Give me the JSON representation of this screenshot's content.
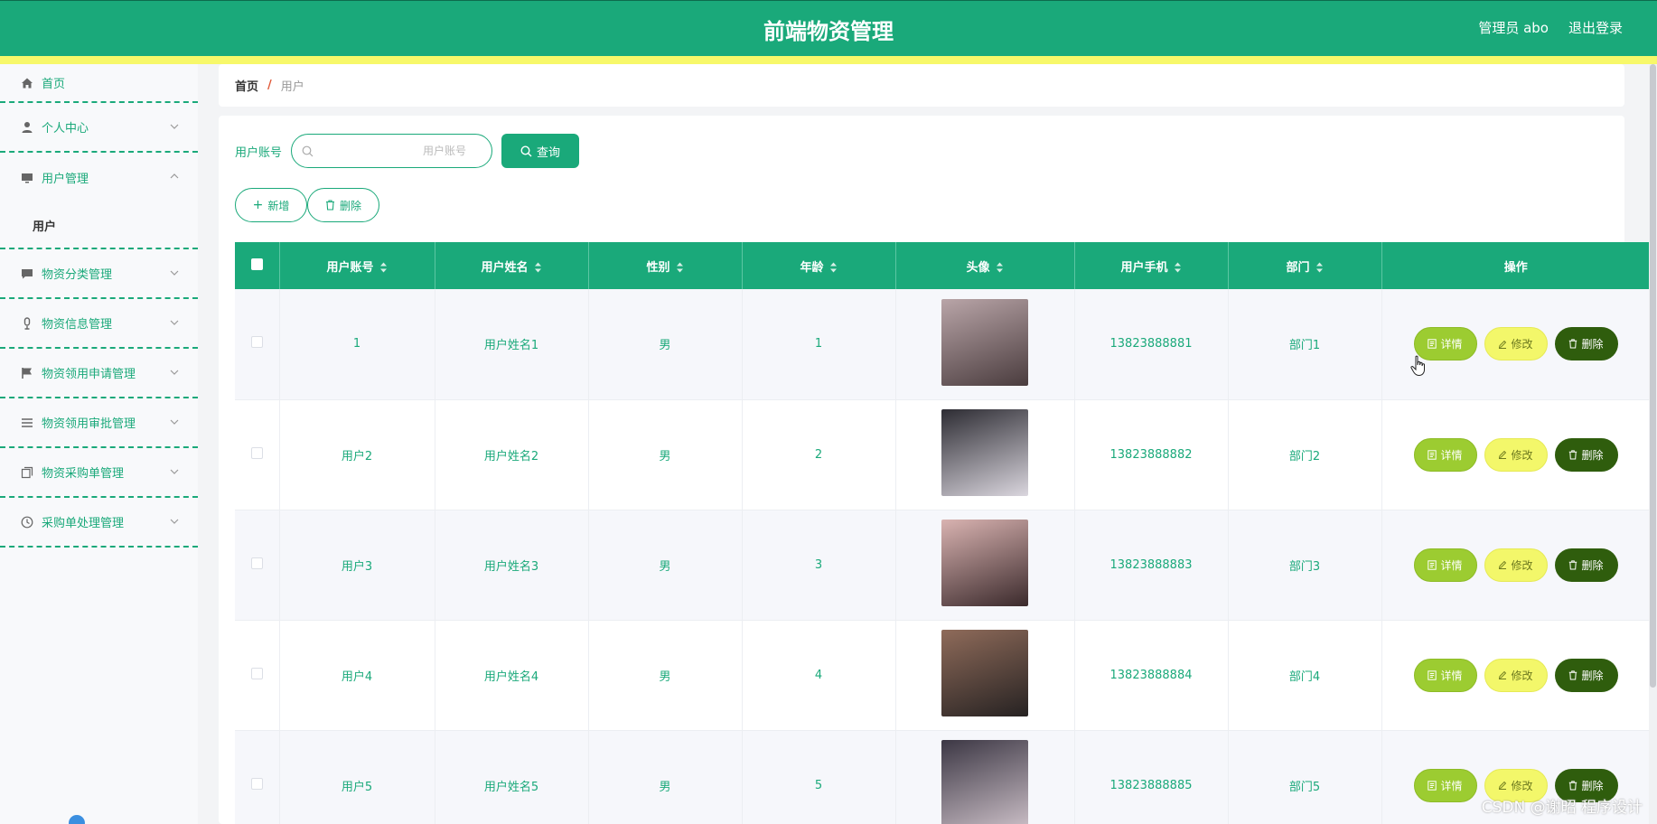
{
  "header": {
    "title": "前端物资管理",
    "user": "管理员 abo",
    "logout": "退出登录",
    "colors": {
      "primary": "#1aa97a",
      "stripe": "#f7f86a"
    }
  },
  "sidebar": {
    "items": [
      {
        "label": "首页",
        "icon": "home-icon"
      },
      {
        "label": "个人中心",
        "icon": "user-icon"
      },
      {
        "label": "用户管理",
        "icon": "monitor-icon",
        "open": true,
        "children": [
          {
            "label": "用户"
          }
        ]
      },
      {
        "label": "物资分类管理",
        "icon": "chat-icon"
      },
      {
        "label": "物资信息管理",
        "icon": "mic-icon"
      },
      {
        "label": "物资领用申请管理",
        "icon": "flag-icon"
      },
      {
        "label": "物资领用审批管理",
        "icon": "list-icon"
      },
      {
        "label": "物资采购单管理",
        "icon": "copy-icon"
      },
      {
        "label": "采购单处理管理",
        "icon": "clock-icon"
      }
    ]
  },
  "breadcrumb": {
    "home": "首页",
    "separator": "/",
    "current": "用户"
  },
  "search": {
    "label": "用户账号",
    "placeholder": "用户账号",
    "value": "",
    "button": "查询"
  },
  "actions": {
    "add": "新增",
    "delete": "删除"
  },
  "table": {
    "columns": [
      "用户账号",
      "用户姓名",
      "性别",
      "年龄",
      "头像",
      "用户手机",
      "部门",
      "操作"
    ],
    "rows": [
      {
        "account": "1",
        "name": "用户姓名1",
        "gender": "男",
        "age": "1",
        "phone": "13823888881",
        "dept": "部门1",
        "avatar_colors": [
          "#b9a5a8",
          "#4a3c3e"
        ]
      },
      {
        "account": "用户2",
        "name": "用户姓名2",
        "gender": "男",
        "age": "2",
        "phone": "13823888882",
        "dept": "部门2",
        "avatar_colors": [
          "#2d2c33",
          "#dad6de"
        ]
      },
      {
        "account": "用户3",
        "name": "用户姓名3",
        "gender": "男",
        "age": "3",
        "phone": "13823888883",
        "dept": "部门3",
        "avatar_colors": [
          "#d9b3b1",
          "#3b2a2c"
        ]
      },
      {
        "account": "用户4",
        "name": "用户姓名4",
        "gender": "男",
        "age": "4",
        "phone": "13823888884",
        "dept": "部门4",
        "avatar_colors": [
          "#8f6b5a",
          "#262222"
        ]
      },
      {
        "account": "用户5",
        "name": "用户姓名5",
        "gender": "男",
        "age": "5",
        "phone": "13823888885",
        "dept": "部门5",
        "avatar_colors": [
          "#3c3744",
          "#c8bcc4"
        ]
      }
    ],
    "ops": {
      "detail": "详情",
      "edit": "修改",
      "delete": "删除"
    }
  },
  "watermark": "CSDN @谢昭 程序设计"
}
